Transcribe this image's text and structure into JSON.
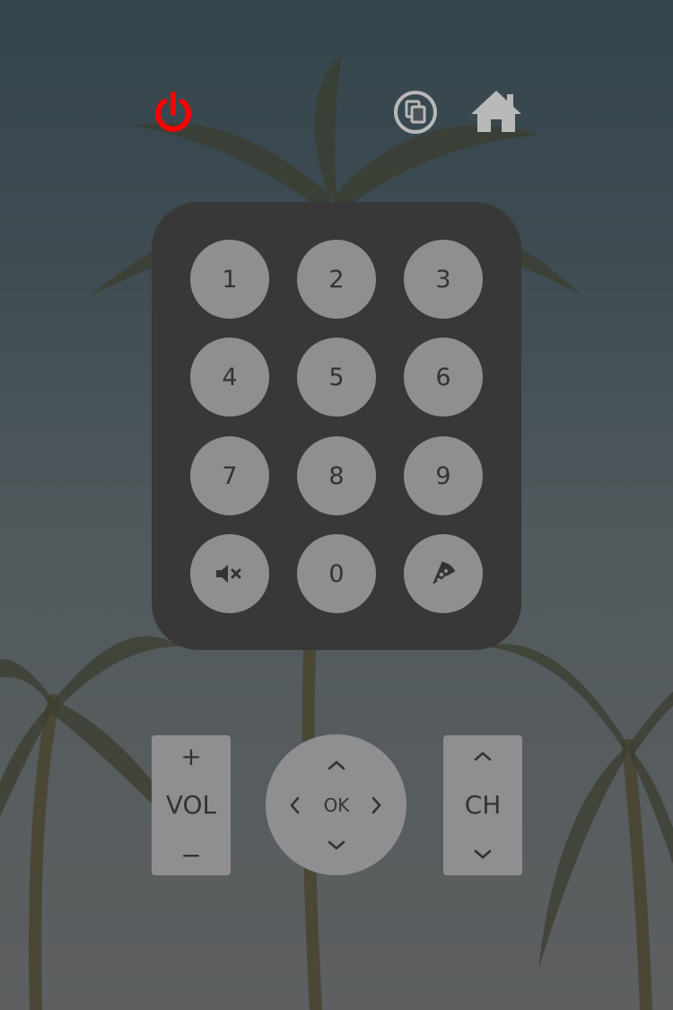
{
  "topbar": {
    "power_icon": "power-icon",
    "copy_icon": "copy-icon",
    "home_icon": "home-icon"
  },
  "keypad": {
    "keys": [
      "1",
      "2",
      "3",
      "4",
      "5",
      "6",
      "7",
      "8",
      "9",
      "",
      "0",
      ""
    ],
    "mute_icon": "mute-icon",
    "input_icon": "pizza-icon"
  },
  "volume": {
    "label": "VOL",
    "up": "+",
    "down": "−"
  },
  "channel": {
    "label": "CH"
  },
  "dpad": {
    "ok": "OK"
  },
  "colors": {
    "power": "#ff0000",
    "panel": "#383838",
    "button": "#8f8f91",
    "button_text": "#333335",
    "icon_light": "#b9b9b9"
  }
}
